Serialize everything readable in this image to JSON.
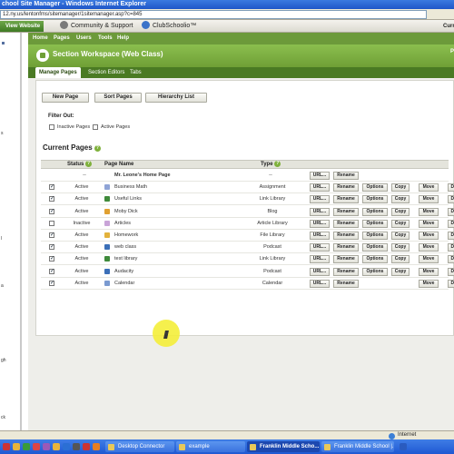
{
  "window": {
    "title": "chool Site Manager - Windows Internet Explorer",
    "url": "12.ny.us/lentonfms/sitemanager/1sitemanager.asp?c=845"
  },
  "favbar": {
    "view_website": "View Website",
    "community_support": "Community & Support",
    "clubschoolio": "ClubSchoolio™",
    "cur_fragment": "Curr"
  },
  "left_pane": {
    "fragments": [
      "s",
      "l",
      "a",
      "gh",
      "ck"
    ]
  },
  "topnav": {
    "items": [
      "Home",
      "Pages",
      "Users",
      "Tools",
      "Help"
    ]
  },
  "workspace": {
    "title": "Section Workspace (Web Class)",
    "right_fragment": "P"
  },
  "tabs": [
    "Manage Pages",
    "Section Editors",
    "Tabs"
  ],
  "actions": {
    "new_page": "New Page",
    "sort_pages": "Sort Pages",
    "hierarchy_list": "Hierarchy List"
  },
  "filter": {
    "title": "Filter Out:",
    "inactive": "Inactive Pages",
    "active": "Active Pages"
  },
  "current_pages": {
    "title": "Current Pages",
    "columns": {
      "status": "Status",
      "page_name": "Page Name",
      "type": "Type"
    },
    "home_row": {
      "status": "--",
      "name": "Mr. Leone's Home Page",
      "type": "--"
    },
    "rows": [
      {
        "checked": true,
        "status": "Active",
        "name": "Business Math",
        "type": "Assignment",
        "icon_color": "#8fa4d6"
      },
      {
        "checked": true,
        "status": "Active",
        "name": "Useful Links",
        "type": "Link Library",
        "icon_color": "#3f8a3a"
      },
      {
        "checked": true,
        "status": "Active",
        "name": "Moby Dick",
        "type": "Blog",
        "icon_color": "#e0a030"
      },
      {
        "checked": false,
        "status": "Inactive",
        "name": "Articles",
        "type": "Article Library",
        "icon_color": "#c9a4d8"
      },
      {
        "checked": true,
        "status": "Active",
        "name": "Homework",
        "type": "File Library",
        "icon_color": "#e3b23c"
      },
      {
        "checked": true,
        "status": "Active",
        "name": "web class",
        "type": "Podcast",
        "icon_color": "#3b6fb8"
      },
      {
        "checked": true,
        "status": "Active",
        "name": "test library",
        "type": "Link Library",
        "icon_color": "#3f8a3a"
      },
      {
        "checked": true,
        "status": "Active",
        "name": "Audacity",
        "type": "Podcast",
        "icon_color": "#3b6fb8"
      },
      {
        "checked": true,
        "status": "Active",
        "name": "Calendar",
        "type": "Calendar",
        "icon_color": "#7a9ad0"
      }
    ],
    "buttons": {
      "url": "URL...",
      "rename": "Rename",
      "options": "Options",
      "copy": "Copy",
      "move": "Move",
      "delete": "Delete"
    }
  },
  "status_bar": {
    "zone": "Internet"
  },
  "taskbar": {
    "items": [
      "Desktop Connector",
      "example",
      "Franklin Middle Scho...",
      "Franklin Middle School |..."
    ]
  },
  "colors": {
    "accent_green": "#6f9f36",
    "tab_green": "#4a7a23",
    "cursor_highlight": "#f5ef3a"
  }
}
